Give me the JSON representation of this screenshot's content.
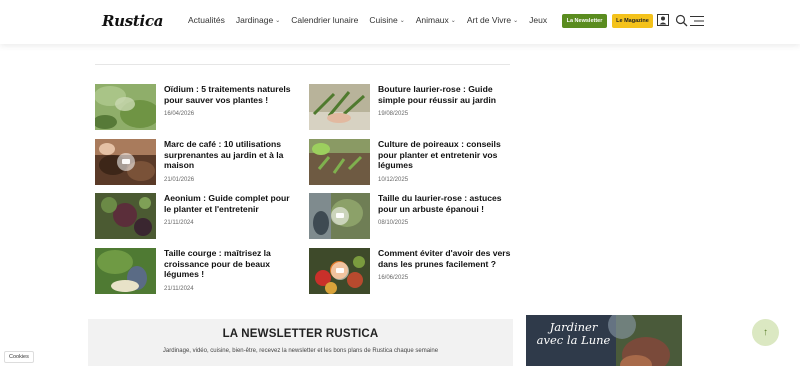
{
  "header": {
    "logo": "Rustica",
    "nav": [
      {
        "label": "Actualités",
        "chevron": false
      },
      {
        "label": "Jardinage",
        "chevron": true
      },
      {
        "label": "Calendrier lunaire",
        "chevron": false
      },
      {
        "label": "Cuisine",
        "chevron": true
      },
      {
        "label": "Animaux",
        "chevron": true
      },
      {
        "label": "Art de Vivre",
        "chevron": true
      },
      {
        "label": "Jeux",
        "chevron": false
      }
    ],
    "newsletter_btn": "La Newsletter",
    "magazine_btn": "Le Magazine",
    "colors": {
      "newsletter": "#5a8c1f",
      "magazine": "#f4c21b"
    }
  },
  "articles": [
    {
      "title": "Oïdium : 5 traitements naturels pour sauver vos plantes !",
      "date": "16/04/2026"
    },
    {
      "title": "Bouture laurier-rose : Guide simple pour réussir au jardin",
      "date": "19/08/2025"
    },
    {
      "title": "Marc de café : 10 utilisations surprenantes au jardin et à la maison",
      "date": "21/01/2026"
    },
    {
      "title": "Culture de poireaux : conseils pour planter et entretenir vos légumes",
      "date": "10/12/2025"
    },
    {
      "title": "Aeonium : Guide complet pour le planter et l'entretenir",
      "date": "21/11/2024"
    },
    {
      "title": "Taille du laurier-rose : astuces pour un arbuste épanoui !",
      "date": "08/10/2025"
    },
    {
      "title": "Taille courge : maîtrisez la croissance pour de beaux légumes !",
      "date": "21/11/2024"
    },
    {
      "title": "Comment éviter d'avoir des vers dans les prunes facilement ?",
      "date": "16/06/2025"
    }
  ],
  "newsletter": {
    "title": "LA NEWSLETTER RUSTICA",
    "subtitle": "Jardinage, vidéo, cuisine, bien-être, recevez la newsletter et les bons plans de Rustica chaque semaine"
  },
  "ad": {
    "text": "Jardiner avec la Lune"
  },
  "scroll_top": "↑",
  "cookies": "Cookies"
}
